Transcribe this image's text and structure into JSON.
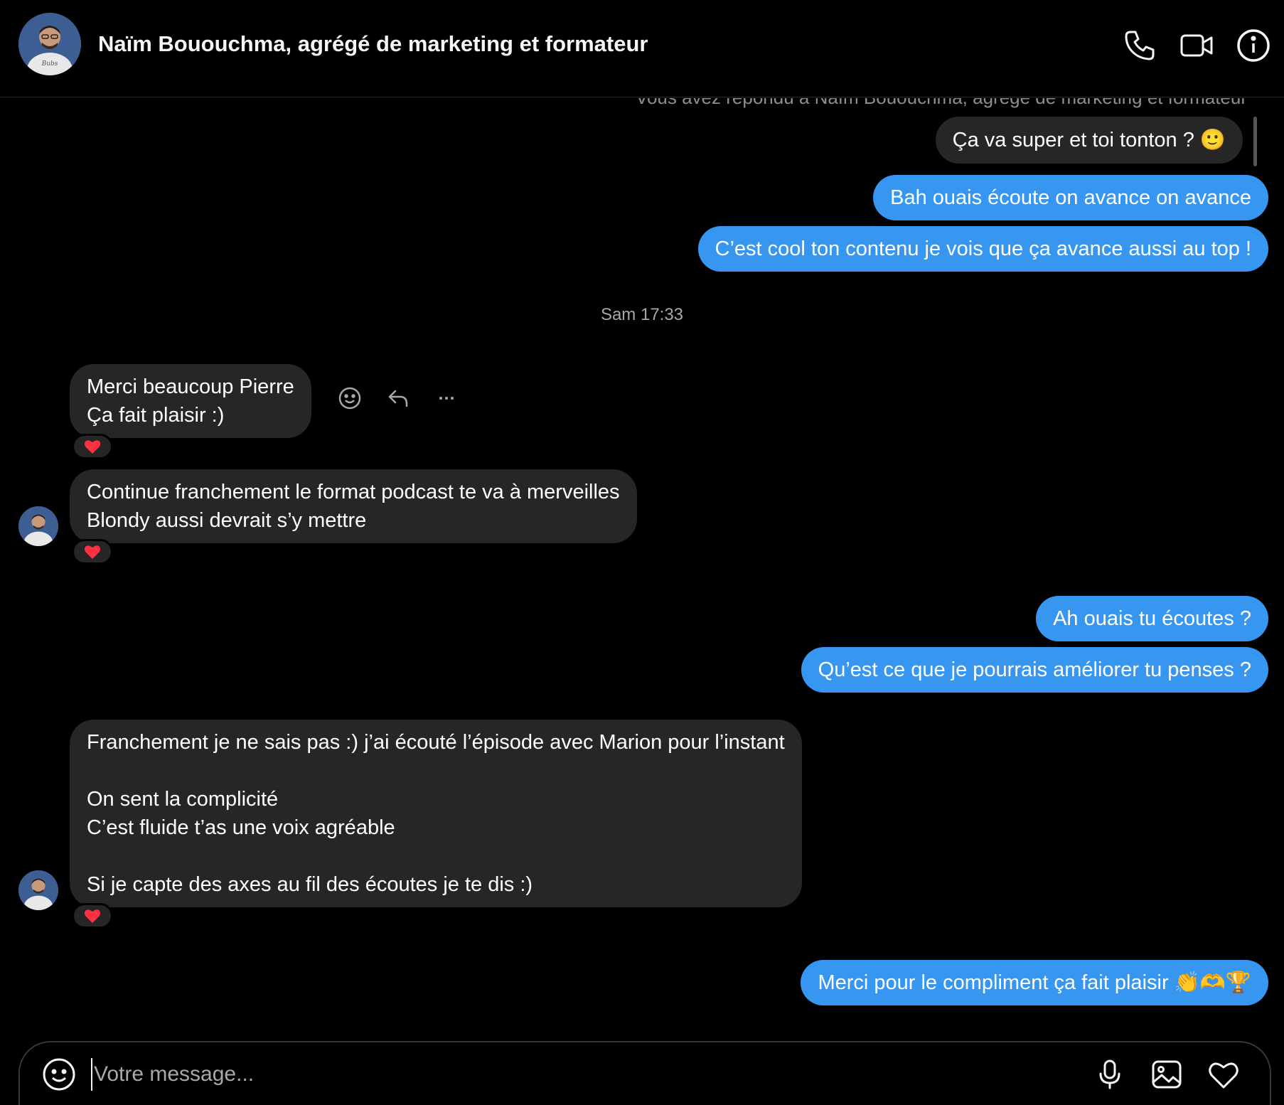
{
  "header": {
    "title": "Naïm Bououchma, agrégé de marketing et formateur",
    "avatar_text": "Bubs"
  },
  "thread": {
    "reply_note": "Vous avez répondu à Naïm Bououchma, agrégé de marketing et formateur",
    "timestamp": "Sam 17:33"
  },
  "messages": [
    {
      "id": "m1",
      "from": "me",
      "kind": "reply",
      "text": "Ça va super et toi tonton ? 🙂"
    },
    {
      "id": "m2",
      "from": "me",
      "text": "Bah ouais écoute on avance on avance"
    },
    {
      "id": "m3",
      "from": "me",
      "text": "C’est cool ton contenu je vois que ça avance aussi au top !"
    },
    {
      "id": "m4",
      "from": "them",
      "text": "Merci beaucoup Pierre\nÇa fait plaisir :)",
      "reaction": "heart"
    },
    {
      "id": "m5",
      "from": "them",
      "text": "Continue franchement le format podcast te va à merveilles\nBlondy aussi devrait s’y mettre",
      "reaction": "heart"
    },
    {
      "id": "m6",
      "from": "me",
      "text": "Ah ouais tu écoutes ?"
    },
    {
      "id": "m7",
      "from": "me",
      "text": "Qu’est ce que je pourrais améliorer tu penses ?"
    },
    {
      "id": "m8",
      "from": "them",
      "text": "Franchement je ne sais pas :) j’ai écouté l’épisode avec Marion pour l’instant\n\nOn sent la complicité\nC’est fluide t’as une voix agréable\n\nSi je capte des axes au fil des écoutes je te dis :)",
      "reaction": "heart"
    },
    {
      "id": "m9",
      "from": "me",
      "text": "Merci pour le compliment ça fait plaisir 👏🫶🏆"
    }
  ],
  "composer": {
    "placeholder": "Votre message..."
  },
  "colors": {
    "sent_bubble": "#3797f0",
    "received_bubble": "#262626",
    "reaction_heart": "#ff3040"
  },
  "icons": {
    "header": [
      "phone-icon",
      "video-icon",
      "info-icon"
    ],
    "hover": [
      "react-emoji-icon",
      "reply-icon",
      "more-icon"
    ],
    "composer": [
      "emoji-icon",
      "microphone-icon",
      "image-icon",
      "heart-icon"
    ]
  }
}
